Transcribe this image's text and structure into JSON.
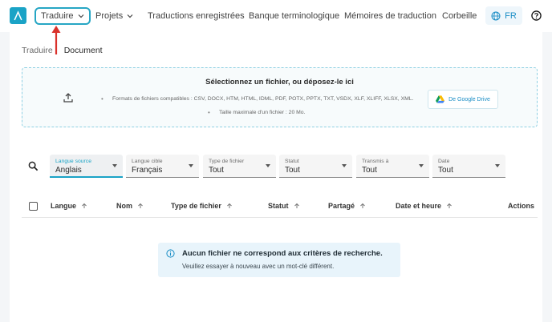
{
  "nav": {
    "items": [
      {
        "label": "Traduire"
      },
      {
        "label": "Projets"
      },
      {
        "label": "Traductions enregistrées"
      },
      {
        "label": "Banque terminologique"
      },
      {
        "label": "Mémoires de traduction"
      },
      {
        "label": "Corbeille"
      }
    ],
    "language": "FR"
  },
  "breadcrumb": {
    "first": "Traduire",
    "second": "Document"
  },
  "dropzone": {
    "title": "Sélectionnez un fichier, ou déposez-le ici",
    "formats": "Formats de fichiers compatibles : CSV, DOCX, HTM, HTML, IDML, PDF, POTX, PPTX, TXT, VSDX, XLF, XLIFF, XLSX, XML.",
    "max_size": "Taille maximale d'un fichier : 20 Mo.",
    "gdrive_label": "De Google Drive"
  },
  "filters": [
    {
      "label": "Langue source",
      "value": "Anglais"
    },
    {
      "label": "Langue cible",
      "value": "Français"
    },
    {
      "label": "Type de fichier",
      "value": "Tout"
    },
    {
      "label": "Statut",
      "value": "Tout"
    },
    {
      "label": "Transmis à",
      "value": "Tout"
    },
    {
      "label": "Date",
      "value": "Tout"
    }
  ],
  "table": {
    "columns": [
      {
        "label": "Langue"
      },
      {
        "label": "Nom"
      },
      {
        "label": "Type de fichier"
      },
      {
        "label": "Statut"
      },
      {
        "label": "Partagé"
      },
      {
        "label": "Date et heure"
      },
      {
        "label": "Actions"
      }
    ]
  },
  "empty_state": {
    "title": "Aucun fichier ne correspond aux critères de recherche.",
    "subtitle": "Veuillez essayer à nouveau avec un mot-clé différent."
  },
  "colors": {
    "accent": "#1aa3c6",
    "annotation_arrow": "#d9312b"
  }
}
